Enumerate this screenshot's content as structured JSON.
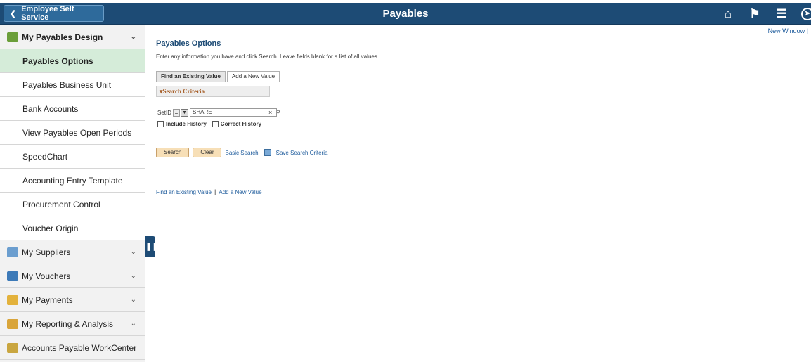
{
  "topbar": {
    "back_label": "Employee Self Service",
    "title": "Payables"
  },
  "sidebar": {
    "groups": [
      {
        "label": "My Payables Design",
        "icon": "payables-design-icon",
        "color": "#6b9e3a"
      },
      {
        "label": "My Suppliers",
        "icon": "suppliers-icon",
        "color": "#6b9ecf"
      },
      {
        "label": "My Vouchers",
        "icon": "vouchers-icon",
        "color": "#3d7ab8"
      },
      {
        "label": "My Payments",
        "icon": "payments-icon",
        "color": "#e3b23c"
      },
      {
        "label": "My Reporting & Analysis",
        "icon": "reporting-icon",
        "color": "#d9a53a"
      },
      {
        "label": "Accounts Payable WorkCenter",
        "icon": "workcenter-icon",
        "color": "#c9a640"
      }
    ],
    "items": [
      "Payables Options",
      "Payables Business Unit",
      "Bank Accounts",
      "View Payables Open Periods",
      "SpeedChart",
      "Accounting Entry Template",
      "Procurement Control",
      "Voucher Origin"
    ]
  },
  "main": {
    "new_window": "New Window",
    "title": "Payables Options",
    "instructions": "Enter any information you have and click Search. Leave fields blank for a list of all values.",
    "tabs": [
      "Find an Existing Value",
      "Add a New Value"
    ],
    "criteria_label": "Search Criteria",
    "setid_label": "SetID",
    "setid_operator": "=",
    "setid_value": "SHARE",
    "include_history": "Include History",
    "correct_history": "Correct History",
    "search_button": "Search",
    "clear_button": "Clear",
    "basic_search": "Basic Search",
    "save_search": "Save Search Criteria",
    "bottom_links": [
      "Find an Existing Value",
      "Add a New Value"
    ]
  }
}
